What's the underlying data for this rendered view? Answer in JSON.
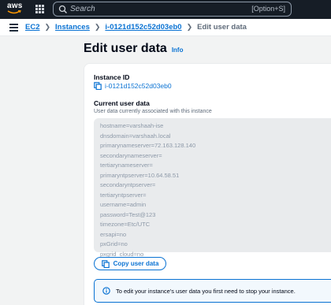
{
  "topnav": {
    "logo_text": "aws",
    "search": {
      "placeholder": "Search",
      "shortcut": "[Option+S]"
    }
  },
  "breadcrumb": {
    "items": [
      "EC2",
      "Instances",
      "i-0121d152c52d03eb0"
    ],
    "current": "Edit user data"
  },
  "page": {
    "title": "Edit user data",
    "info_label": "Info"
  },
  "instance": {
    "label": "Instance ID",
    "id": "i-0121d152c52d03eb0"
  },
  "current_user_data": {
    "label": "Current user data",
    "description": "User data currently associated with this instance",
    "lines": [
      "hostname=varshaah-ise",
      "dnsdomain=varshaah.local",
      "primarynameserver=72.163.128.140",
      "secondarynameserver=",
      "tertiarynameserver=",
      "primaryntpserver=10.64.58.51",
      "secondaryntpserver=",
      "tertiaryntpserver=",
      "username=admin",
      "password=Test@123",
      "timezone=Etc/UTC",
      "ersapi=no",
      "pxGrid=no",
      "pxgrid_cloud=no"
    ]
  },
  "copy_button": {
    "label": "Copy user data"
  },
  "alert": {
    "text": "To edit your instance's user data you first need to stop your instance."
  },
  "colors": {
    "nav_bg": "#161d26",
    "link": "#0972d3",
    "page_bg": "#f2f3f3",
    "info_bg": "#f2f8fd"
  }
}
